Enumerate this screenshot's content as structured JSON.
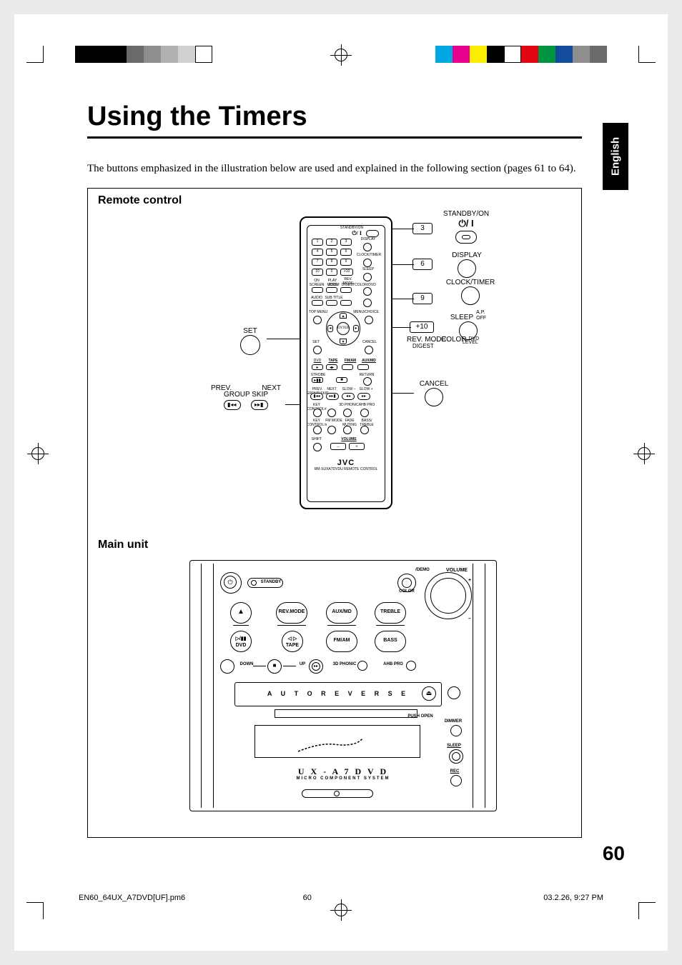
{
  "page": {
    "title": "Using the Timers",
    "intro": "The buttons emphasized in the illustration below are used and explained in the following section (pages 61 to 64).",
    "language_tab": "English",
    "page_number": "60"
  },
  "footer": {
    "filename": "EN60_64UX_A7DVD[UF].pm6",
    "page": "60",
    "timestamp": "03.2.26, 9:27 PM"
  },
  "panel_titles": {
    "remote": "Remote control",
    "main": "Main unit"
  },
  "remote_callouts": {
    "set": "SET",
    "prev_next_top": "PREV.",
    "prev_next_top2": "NEXT",
    "group_skip": "GROUP SKIP",
    "standby": "STANDBY/ON",
    "display": "DISPLAY",
    "clock_timer": "CLOCK/TIMER",
    "sleep": "SLEEP",
    "ap_off_top": "A.P.",
    "ap_off_bot": "OFF",
    "rev_mode": "REV. MODE",
    "digest": "DIGEST",
    "color": "COLOR",
    "dvd_level": "DVD LEVEL",
    "cancel": "CANCEL",
    "key3": "3",
    "key6": "6",
    "key9": "9",
    "key_plus10": "+10"
  },
  "remote_tiny": {
    "standby_on": "STANDBY/ON",
    "display": "DISPLAY",
    "clock_timer": "CLOCK/TIMER",
    "sleep": "SLEEP",
    "on_screen": "ON SCREEN",
    "play_mode": "PLAY MODE",
    "rev_mode": "REV. MODE",
    "zoom": "ZOOM",
    "digest": "DIGEST",
    "color": "COLOR/DVD",
    "audio": "AUDIO",
    "sub_title": "SUB TITLE",
    "top_menu": "TOP MENU",
    "menu_choice": "MENU/CHOICE",
    "enter": "ENTER",
    "set": "SET",
    "cancel": "CANCEL",
    "dvd": "DVD",
    "tape": "TAPE",
    "fmam": "FM/AM",
    "auxmd": "AUX/MD",
    "strobe": "STROBE",
    "return": "RETURN",
    "prev_group": "PREV. GROUP SKIP",
    "next_group": "NEXT",
    "slow_minus": "SLOW –",
    "slow_plus": "SLOW +",
    "key_ctrl_a": "KEY CONTROL#",
    "key_ctrl_b": "KEY CONTROL b",
    "phonic3d": "3D PHONIC",
    "ahb_pro": "AHB PRO",
    "fm_mode": "FM MODE",
    "fade_muting": "FADE MUTING",
    "bass_treble": "BASS/ TREBLE",
    "shift": "SHIFT",
    "volume": "VOLUME",
    "brand": "JVC",
    "remote_model": "RM-SUXA7DVDU REMOTE CONTROL",
    "numbers": [
      "1",
      "2",
      "3",
      "4",
      "5",
      "6",
      "7",
      "8",
      "9",
      "10",
      "0",
      "+10"
    ]
  },
  "main_unit": {
    "standby": "STANDBY",
    "rev_mode": "REV.MODE",
    "aux_md": "AUX/MD",
    "treble": "TREBLE",
    "dvd": "DVD",
    "tape": "TAPE",
    "fmam": "FM/AM",
    "bass": "BASS",
    "down": "DOWN",
    "up": "UP",
    "phonic3d": "3D PHONIC",
    "ahb_pro": "AHB PRO",
    "color": "COLOR",
    "demo": "/DEMO",
    "volume": "VOLUME",
    "auto_reverse": "A U T O   R E V E R S E",
    "push_open": "PUSH OPEN",
    "dimmer": "DIMMER",
    "sleep": "SLEEP",
    "rec": "REC",
    "model": "U X - A 7 D V D",
    "subtitle": "MICRO COMPONENT SYSTEM"
  },
  "swatches_left": [
    "#000000",
    "#000000",
    "#000000",
    "#6b6969",
    "#8f8d8e",
    "#b1afaf",
    "#d2d0d1",
    "#ffffff"
  ],
  "swatches_right": [
    "#00a7e3",
    "#e7008b",
    "#fdee00",
    "#000000",
    "#ffffff",
    "#e20613",
    "#009540",
    "#144b9b",
    "#8f8d8e",
    "#6b6969"
  ]
}
